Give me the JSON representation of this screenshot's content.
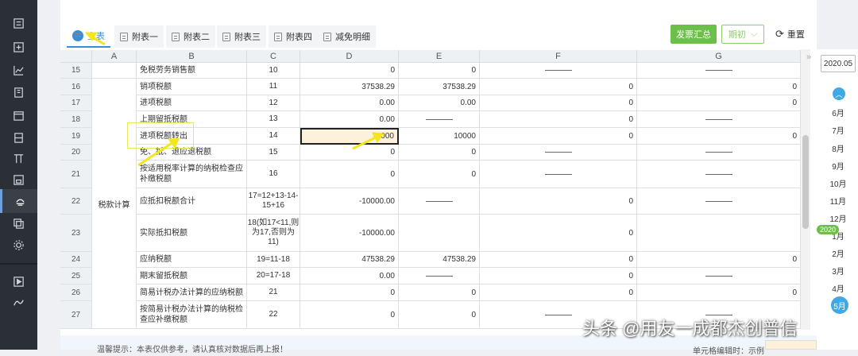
{
  "tabs": [
    {
      "label": "主表",
      "active": true
    },
    {
      "label": "附表一"
    },
    {
      "label": "附表二"
    },
    {
      "label": "附表三"
    },
    {
      "label": "附表四"
    },
    {
      "label": "减免明细"
    }
  ],
  "toolbar": {
    "invoice_summary_label": "发票汇总",
    "period_label": "期初",
    "reset_label": "重置"
  },
  "columns": [
    "",
    "A",
    "B",
    "C",
    "D",
    "E",
    "F",
    "G"
  ],
  "section_label": "税款计算",
  "rows": [
    {
      "n": "15",
      "b": "免税劳务销售额",
      "c": "10",
      "d": "0",
      "e": "0",
      "f": "—",
      "g": "—"
    },
    {
      "n": "16",
      "b": "销项税额",
      "c": "11",
      "d": "37538.29",
      "e": "37538.29",
      "f": "0",
      "g": "0"
    },
    {
      "n": "17",
      "b": "进项税额",
      "c": "12",
      "d": "0.00",
      "e": "0.00",
      "f": "0",
      "g": "0"
    },
    {
      "n": "18",
      "b": "上期留抵税额",
      "c": "13",
      "d": "0.00",
      "e": "—",
      "f": "0",
      "g": "—"
    },
    {
      "n": "19",
      "b": "进项税额转出",
      "c": "14",
      "d": "10000",
      "e": "10000",
      "f": "0",
      "g": "0"
    },
    {
      "n": "20",
      "b": "免、抵、退应退税额",
      "c": "15",
      "d": "0",
      "e": "0",
      "f": "—",
      "g": "—"
    },
    {
      "n": "21",
      "b": "按适用税率计算的纳税检查应补缴税额",
      "c": "16",
      "d": "0",
      "e": "0",
      "f": "—",
      "g": "—"
    },
    {
      "n": "22",
      "b": "应抵扣税额合计",
      "c": "17=12+13-14-15+16",
      "d": "-10000.00",
      "e": "—",
      "f": "0",
      "g": "—"
    },
    {
      "n": "23",
      "b": "实际抵扣税额",
      "c": "18(如17<11,则为17,否则为11)",
      "d": "-10000.00",
      "e": "",
      "f": "0",
      "g": ""
    },
    {
      "n": "24",
      "b": "应纳税额",
      "c": "19=11-18",
      "d": "47538.29",
      "e": "47538.29",
      "f": "0",
      "g": "0"
    },
    {
      "n": "25",
      "b": "期末留抵税额",
      "c": "20=17-18",
      "d": "0.00",
      "e": "—",
      "f": "0",
      "g": "—"
    },
    {
      "n": "26",
      "b": "简易计税办法计算的应纳税额",
      "c": "21",
      "d": "0",
      "e": "0",
      "f": "0",
      "g": "0"
    },
    {
      "n": "27",
      "b": "按简易计税办法计算的纳税检查应补缴税额",
      "c": "22",
      "d": "0",
      "e": "0",
      "f": "—",
      "g": "—"
    }
  ],
  "footer_tip": "温馨提示：本表仅供参考，请认真核对数据后再上报！",
  "footer_right": "单元格编辑时：示例",
  "period_picker": {
    "current": "2020.05",
    "year_badge": "2020",
    "months_above": [
      "6月",
      "7月",
      "8月",
      "9月",
      "10月",
      "11月",
      "12月"
    ],
    "months_below": [
      "1月",
      "2月",
      "3月",
      "4月"
    ],
    "active_month": "5月"
  },
  "watermark": "头条 @用友一成都杰创普信",
  "colors": {
    "accent": "#3b8ed6",
    "green": "#6cc04a",
    "selected_cell": "#fdf1dc",
    "sidebar": "#2b2f36"
  }
}
